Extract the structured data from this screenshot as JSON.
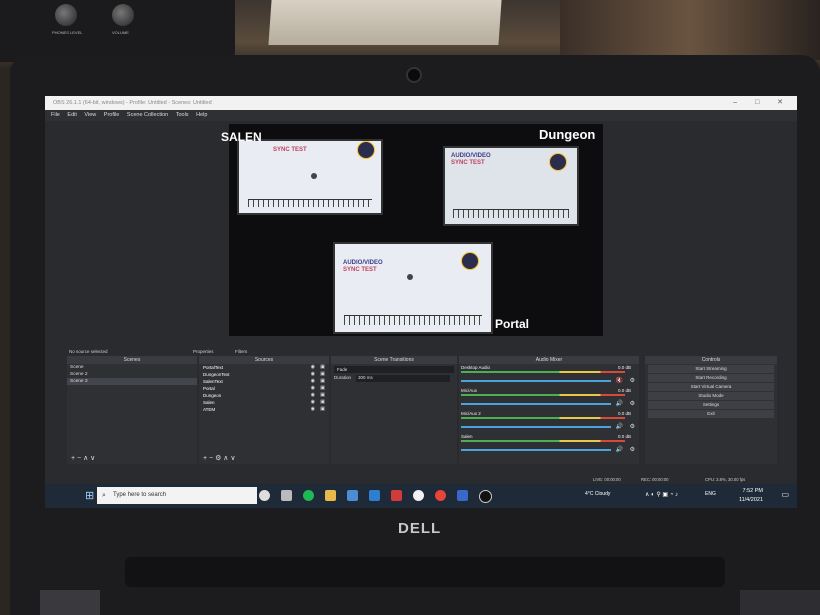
{
  "window": {
    "title": "OBS 26.1.1 (64-bit, windows) - Profile: Untitled - Scenes: Untitled",
    "controls": "–  □  ✕"
  },
  "menu": [
    "File",
    "Edit",
    "View",
    "Profile",
    "Scene Collection",
    "Tools",
    "Help"
  ],
  "preview": {
    "sources": {
      "salen": "SALEN",
      "dungeon": "Dungeon",
      "portal": "Portal"
    },
    "card_title_1": "AUDIO/VIDEO",
    "card_title_2": "SYNC TEST"
  },
  "status_row": {
    "no_source": "No source selected",
    "properties": "Properties",
    "filters": "Filters"
  },
  "scenes": {
    "title": "Scenes",
    "items": [
      "Scene",
      "Scene 2",
      "Scene 3"
    ],
    "selected_index": 2,
    "footer": "+ − ∧ ∨"
  },
  "sources": {
    "title": "Sources",
    "items": [
      "PortalText",
      "DungeonText",
      "SalenText",
      "Portal",
      "Dungeon",
      "Salen",
      "ATEM"
    ],
    "footer": "+ − ⚙ ∧ ∨"
  },
  "transitions": {
    "title": "Scene Transitions",
    "type": "Fade",
    "duration_label": "Duration",
    "duration_value": "300 ms"
  },
  "mixer": {
    "title": "Audio Mixer",
    "channels": [
      {
        "name": "Desktop Audio",
        "db": "0.0 dB",
        "muted": true
      },
      {
        "name": "Mic/Aux",
        "db": "0.0 dB",
        "muted": false
      },
      {
        "name": "Mic/Aux 2",
        "db": "0.0 dB",
        "muted": false
      },
      {
        "name": "Salen",
        "db": "0.0 dB",
        "muted": false
      }
    ]
  },
  "controls": {
    "title": "Controls",
    "buttons": [
      "Start Streaming",
      "Start Recording",
      "Start Virtual Camera",
      "Studio Mode",
      "Settings",
      "Exit"
    ]
  },
  "infobar": {
    "live": "LIVE: 00:00:00",
    "rec": "REC: 00:00:00",
    "cpu": "CPU: 3.8%, 30.00 fps"
  },
  "taskbar": {
    "search_placeholder": "Type here to search",
    "weather": "4°C Cloudy",
    "lang": "ENG",
    "time": "7:52 PM",
    "date": "11/4/2021"
  },
  "laptop_brand": "DELL"
}
